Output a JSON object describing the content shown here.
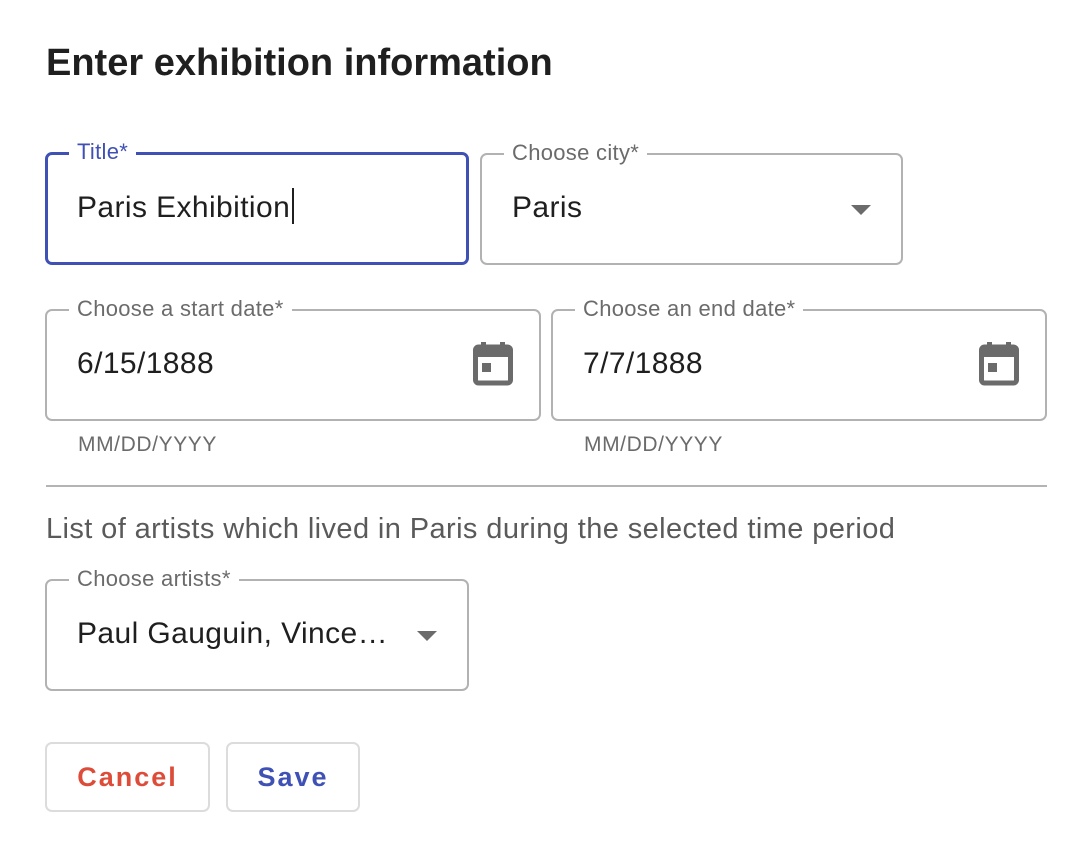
{
  "heading": "Enter exhibition information",
  "fields": {
    "title": {
      "label": "Title*",
      "value": "Paris Exhibition"
    },
    "city": {
      "label": "Choose city*",
      "value": "Paris"
    },
    "start_date": {
      "label": "Choose a start date*",
      "value": "6/15/1888",
      "helper": "MM/DD/YYYY"
    },
    "end_date": {
      "label": "Choose an end date*",
      "value": "7/7/1888",
      "helper": "MM/DD/YYYY"
    },
    "artists": {
      "label": "Choose artists*",
      "value": "Paul Gauguin, Vince…"
    }
  },
  "section_text": "List of artists which lived in Paris during the selected time period",
  "buttons": {
    "cancel": "Cancel",
    "save": "Save"
  },
  "icons": {
    "date_picker": "calendar-icon",
    "dropdown": "arrow-drop-down-icon"
  },
  "colors": {
    "accent": "#3f51b5",
    "cancel": "#dd4b39",
    "border": "#b2b2b2",
    "label": "#6b6b6b"
  }
}
